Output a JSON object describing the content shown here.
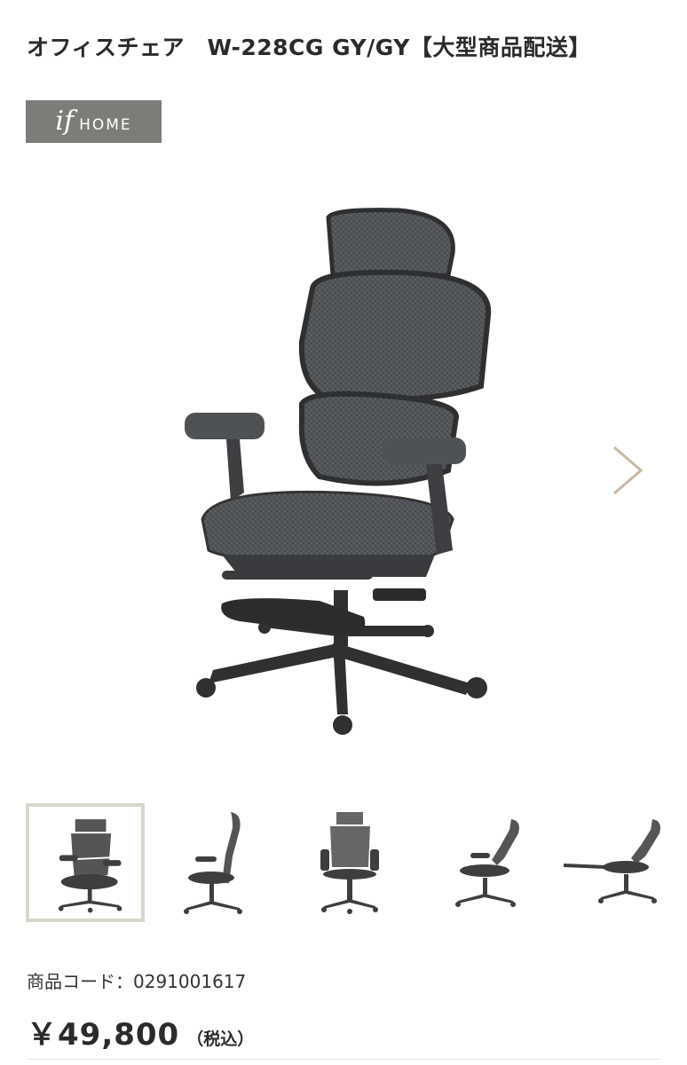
{
  "product": {
    "title": "オフィスチェア　W-228CG GY/GY【大型商品配送】",
    "brand_mark": "if",
    "brand_text": "HOME",
    "code_label": "商品コード：",
    "code_value": "0291001617",
    "price": "￥49,800",
    "tax_note": "（税込）"
  },
  "gallery": {
    "main_view": "front-angle",
    "next_icon": "chevron-right-icon",
    "thumbnails": [
      {
        "view": "front-angle",
        "selected": true
      },
      {
        "view": "side"
      },
      {
        "view": "back"
      },
      {
        "view": "side-reclined"
      },
      {
        "view": "reclined-footrest"
      }
    ]
  },
  "colors": {
    "brand_bg": "#7c7c79",
    "thumb_border": "#d9d6cc",
    "chevron": "#c9b9a3",
    "chair": "#3d3e40"
  }
}
